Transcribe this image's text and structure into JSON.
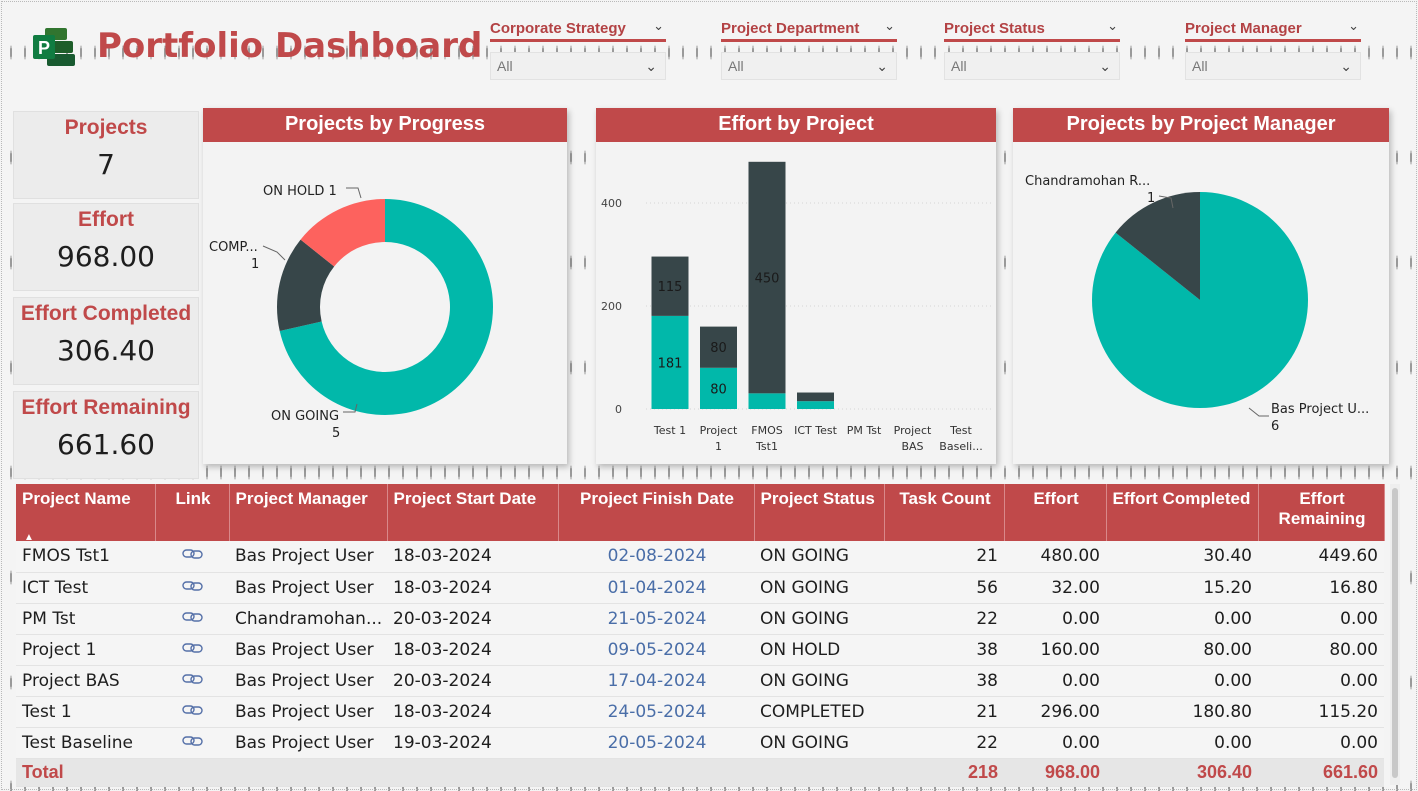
{
  "header": {
    "title": "Portfolio Dashboard",
    "logo_icon": "ms-project-logo"
  },
  "slicers": [
    {
      "label": "Corporate Strategy",
      "value": "All"
    },
    {
      "label": "Project Department",
      "value": "All"
    },
    {
      "label": "Project Status",
      "value": "All"
    },
    {
      "label": "Project Manager",
      "value": "All"
    }
  ],
  "kpis": [
    {
      "label": "Projects",
      "value": "7"
    },
    {
      "label": "Effort",
      "value": "968.00"
    },
    {
      "label": "Effort Completed",
      "value": "306.40"
    },
    {
      "label": "Effort Remaining",
      "value": "661.60"
    }
  ],
  "colors": {
    "accent": "#c0494a",
    "teal": "#01b8aa",
    "dark": "#374649",
    "coral": "#fd625e"
  },
  "charts": {
    "progress": {
      "title": "Projects by Progress",
      "labels": {
        "on_hold": "ON HOLD 1",
        "completed_name": "COMP...",
        "completed_value": "1",
        "ongoing_name": "ON GOING",
        "ongoing_value": "5"
      }
    },
    "effort": {
      "title": "Effort by Project",
      "ticks": [
        "0",
        "200",
        "400"
      ],
      "category_lines": [
        [
          "Test 1"
        ],
        [
          "Project",
          "1"
        ],
        [
          "FMOS",
          "Tst1"
        ],
        [
          "ICT Test"
        ],
        [
          "PM Tst"
        ],
        [
          "Project",
          "BAS"
        ],
        [
          "Test",
          "Baseli..."
        ]
      ]
    },
    "manager": {
      "title": "Projects by Project Manager",
      "labels": {
        "chandra_name": "Chandramohan R...",
        "chandra_value": "1",
        "bas_name": "Bas Project U...",
        "bas_value": "6"
      }
    }
  },
  "chart_data": [
    {
      "type": "pie",
      "title": "Projects by Progress",
      "donut": true,
      "slices": [
        {
          "name": "ON GOING",
          "value": 5,
          "color": "#01b8aa"
        },
        {
          "name": "COMPLETED",
          "value": 1,
          "color": "#374649"
        },
        {
          "name": "ON HOLD",
          "value": 1,
          "color": "#fd625e"
        }
      ]
    },
    {
      "type": "bar",
      "title": "Effort by Project",
      "stacked": true,
      "categories": [
        "Test 1",
        "Project 1",
        "FMOS Tst1",
        "ICT Test",
        "PM Tst",
        "Project BAS",
        "Test Baseline"
      ],
      "series": [
        {
          "values": [
            180.8,
            80,
            30.4,
            15.2,
            0,
            0,
            0
          ],
          "color": "#01b8aa"
        },
        {
          "values": [
            115.2,
            80,
            449.6,
            16.8,
            0,
            0,
            0
          ],
          "color": "#374649"
        }
      ],
      "data_labels": [
        {
          "series": 0,
          "index": 0,
          "text": "181"
        },
        {
          "series": 1,
          "index": 0,
          "text": "115"
        },
        {
          "series": 0,
          "index": 1,
          "text": "80"
        },
        {
          "series": 1,
          "index": 1,
          "text": "80"
        },
        {
          "series": 1,
          "index": 2,
          "text": "450"
        }
      ],
      "ylim": [
        0,
        500
      ],
      "yticks": [
        0,
        200,
        400
      ],
      "grid": true
    },
    {
      "type": "pie",
      "title": "Projects by Project Manager",
      "slices": [
        {
          "name": "Bas Project U...",
          "value": 6,
          "color": "#01b8aa"
        },
        {
          "name": "Chandramohan R...",
          "value": 1,
          "color": "#374649"
        }
      ]
    }
  ],
  "table": {
    "columns": [
      "Project Name",
      "Link",
      "Project Manager",
      "Project Start Date",
      "Project Finish Date",
      "Project Status",
      "Task Count",
      "Effort",
      "Effort Completed",
      "Effort Remaining"
    ],
    "link_icon": "link-icon",
    "rows": [
      [
        "FMOS Tst1",
        "Bas Project User",
        "18-03-2024",
        "02-08-2024",
        "ON GOING",
        "21",
        "480.00",
        "30.40",
        "449.60"
      ],
      [
        "ICT Test",
        "Bas Project User",
        "18-03-2024",
        "01-04-2024",
        "ON GOING",
        "56",
        "32.00",
        "15.20",
        "16.80"
      ],
      [
        "PM Tst",
        "Chandramohan...",
        "20-03-2024",
        "21-05-2024",
        "ON GOING",
        "22",
        "0.00",
        "0.00",
        "0.00"
      ],
      [
        "Project 1",
        "Bas Project User",
        "18-03-2024",
        "09-05-2024",
        "ON HOLD",
        "38",
        "160.00",
        "80.00",
        "80.00"
      ],
      [
        "Project BAS",
        "Bas Project User",
        "20-03-2024",
        "17-04-2024",
        "ON GOING",
        "38",
        "0.00",
        "0.00",
        "0.00"
      ],
      [
        "Test 1",
        "Bas Project User",
        "18-03-2024",
        "24-05-2024",
        "COMPLETED",
        "21",
        "296.00",
        "180.80",
        "115.20"
      ],
      [
        "Test Baseline",
        "Bas Project User",
        "19-03-2024",
        "20-05-2024",
        "ON GOING",
        "22",
        "0.00",
        "0.00",
        "0.00"
      ]
    ],
    "total": {
      "label": "Total",
      "task_count": "218",
      "effort": "968.00",
      "effort_completed": "306.40",
      "effort_remaining": "661.60"
    }
  }
}
